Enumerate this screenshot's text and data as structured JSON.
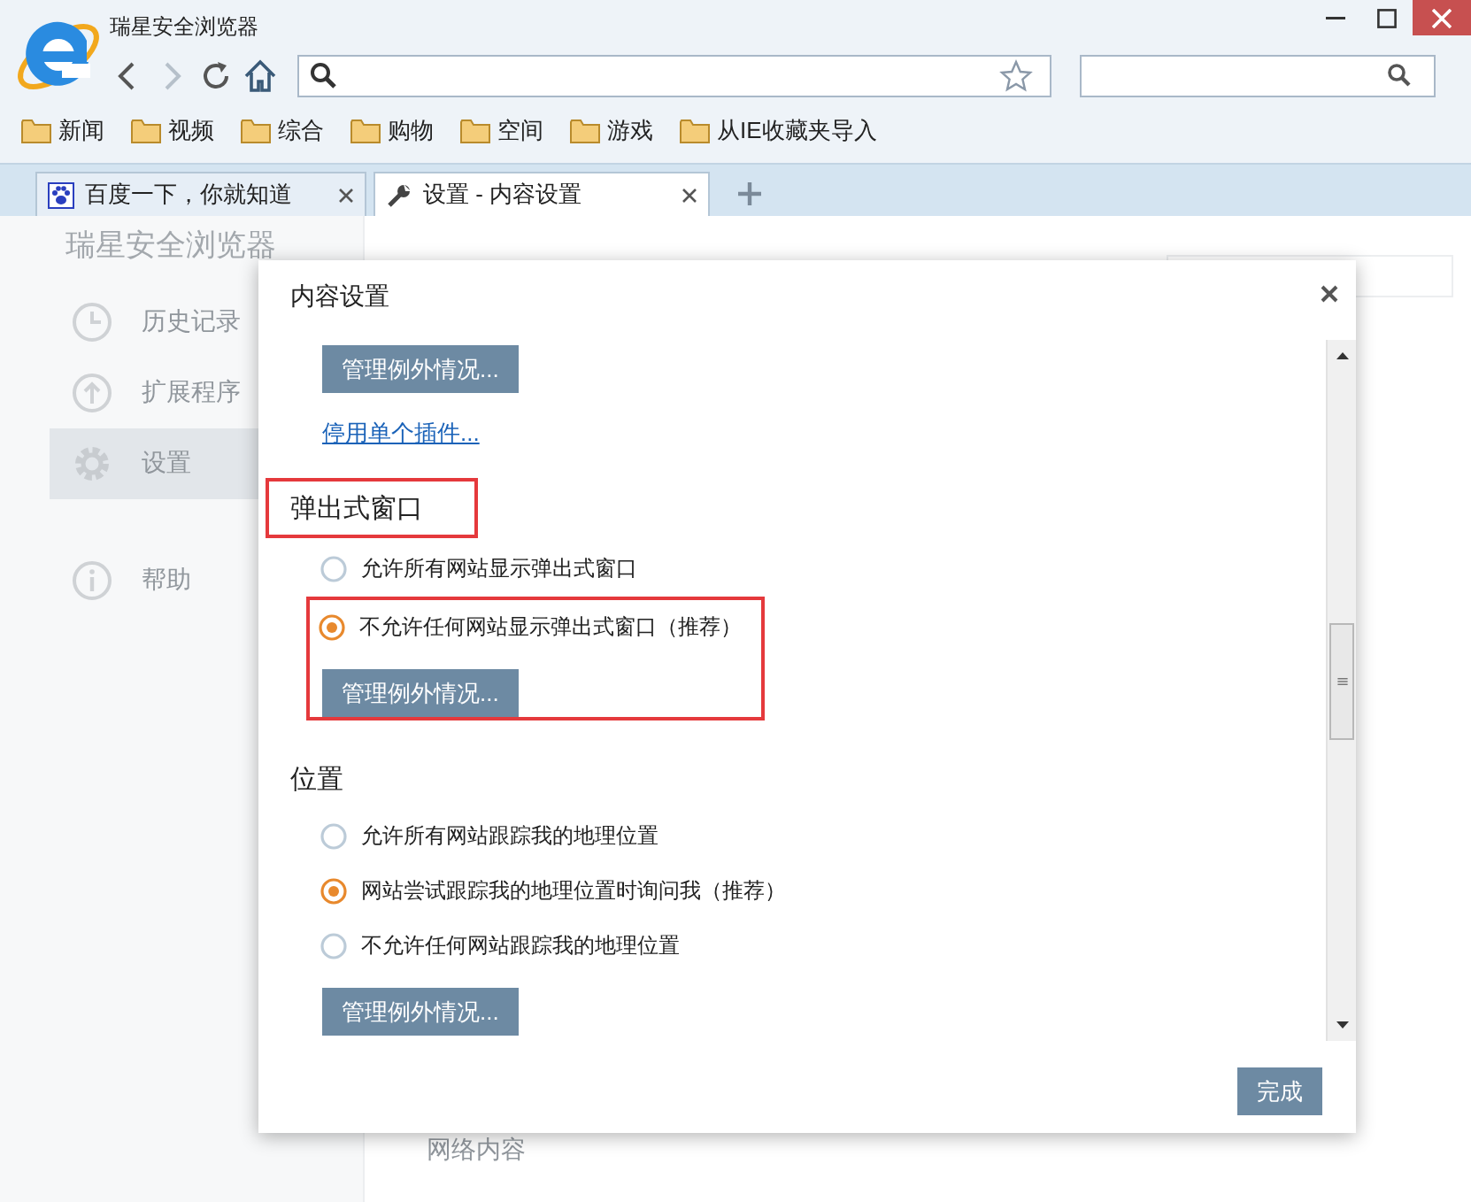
{
  "window": {
    "title": "瑞星安全浏览器"
  },
  "bookmarks": [
    {
      "label": "新闻"
    },
    {
      "label": "视频"
    },
    {
      "label": "综合"
    },
    {
      "label": "购物"
    },
    {
      "label": "空间"
    },
    {
      "label": "游戏"
    },
    {
      "label": "从IE收藏夹导入"
    }
  ],
  "tabs": [
    {
      "label": "百度一下，你就知道",
      "selected": false
    },
    {
      "label": "设置 - 内容设置",
      "selected": true
    }
  ],
  "sidebar": {
    "title": "瑞星安全浏览器",
    "items": [
      {
        "label": "历史记录",
        "selected": false
      },
      {
        "label": "扩展程序",
        "selected": false
      },
      {
        "label": "设置",
        "selected": true
      },
      {
        "label": "帮助",
        "selected": false
      }
    ]
  },
  "page": {
    "section_below": "网络内容"
  },
  "dialog": {
    "title": "内容设置",
    "content": [
      {
        "kind": "button",
        "label": "管理例外情况...",
        "highlighted": false
      },
      {
        "kind": "link",
        "label": "停用单个插件...",
        "highlighted": false
      },
      {
        "kind": "heading",
        "label": "弹出式窗口",
        "highlighted": true
      },
      {
        "kind": "radio",
        "label": "允许所有网站显示弹出式窗口",
        "selected": false,
        "highlighted": false
      },
      {
        "kind": "radio",
        "label": "不允许任何网站显示弹出式窗口（推荐）",
        "selected": true,
        "highlighted": true
      },
      {
        "kind": "button",
        "label": "管理例外情况...",
        "highlighted": true
      },
      {
        "kind": "heading",
        "label": "位置",
        "highlighted": false
      },
      {
        "kind": "radio",
        "label": "允许所有网站跟踪我的地理位置",
        "selected": false,
        "highlighted": false
      },
      {
        "kind": "radio",
        "label": "网站尝试跟踪我的地理位置时询问我（推荐）",
        "selected": true,
        "highlighted": false
      },
      {
        "kind": "radio",
        "label": "不允许任何网站跟踪我的地理位置",
        "selected": false,
        "highlighted": false
      },
      {
        "kind": "button",
        "label": "管理例外情况...",
        "highlighted": false
      }
    ],
    "done": "完成"
  }
}
